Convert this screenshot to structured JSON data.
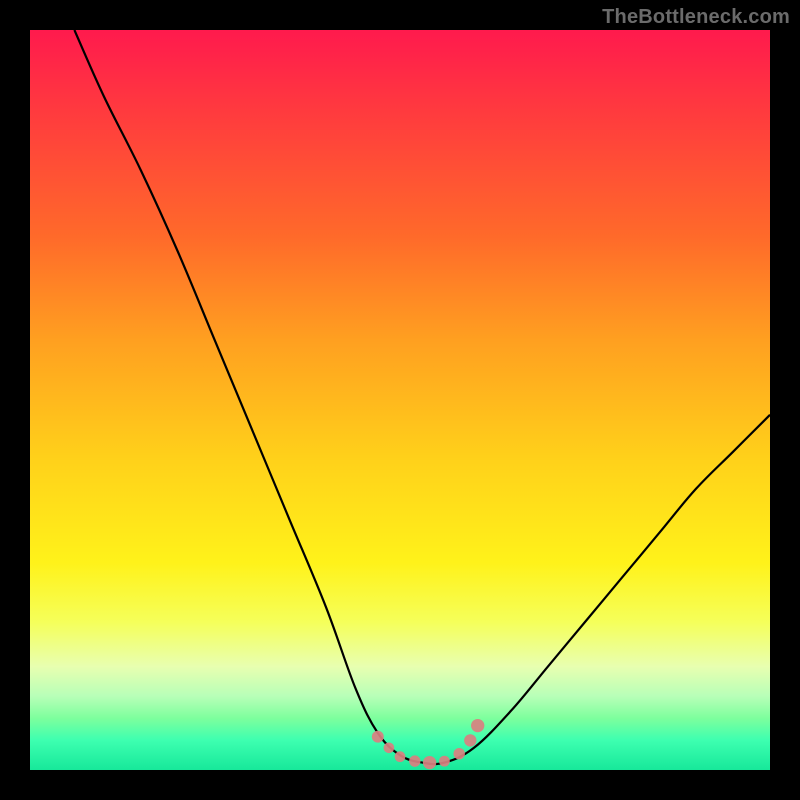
{
  "watermark": "TheBottleneck.com",
  "chart_data": {
    "type": "line",
    "title": "",
    "xlabel": "",
    "ylabel": "",
    "xlim": [
      0,
      100
    ],
    "ylim": [
      0,
      100
    ],
    "grid": false,
    "legend": false,
    "background_gradient": {
      "top_color": "#ff1a4d",
      "bottom_color": "#17e89a",
      "note": "vertical gradient red→orange→yellow→green representing bottleneck severity (high at top, low at bottom)"
    },
    "series": [
      {
        "name": "bottleneck-curve",
        "x": [
          6,
          10,
          15,
          20,
          25,
          30,
          35,
          40,
          44,
          47,
          50,
          53,
          56,
          60,
          65,
          70,
          75,
          80,
          85,
          90,
          95,
          100
        ],
        "y": [
          100,
          91,
          81,
          70,
          58,
          46,
          34,
          22,
          11,
          5,
          2,
          1,
          1,
          3,
          8,
          14,
          20,
          26,
          32,
          38,
          43,
          48
        ],
        "color": "#000000"
      },
      {
        "name": "optimal-zone-markers",
        "x": [
          47,
          48.5,
          50,
          52,
          54,
          56,
          58,
          59.5,
          60.5
        ],
        "y": [
          4.5,
          3,
          1.8,
          1.2,
          1.0,
          1.2,
          2.2,
          4.0,
          6.0
        ],
        "color": "#d98080",
        "marker": "circle"
      }
    ],
    "annotations": []
  },
  "colors": {
    "frame": "#000000",
    "curve": "#000000",
    "markers": "#d98080"
  }
}
